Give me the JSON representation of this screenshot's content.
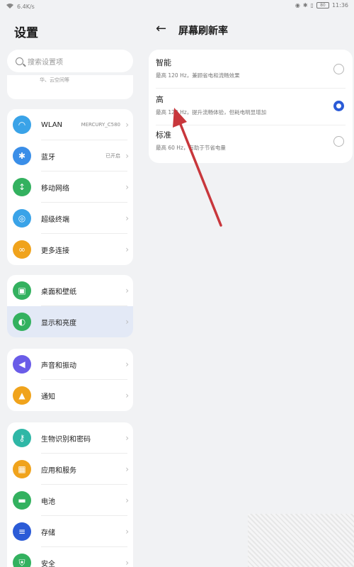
{
  "status_bar": {
    "left_text": "6.4K/s",
    "time": "11:36",
    "battery": "80"
  },
  "left": {
    "title": "设置",
    "search_placeholder": "搜索设置项",
    "account_hint": "华、云空间等",
    "groups": [
      [
        {
          "label": "WLAN",
          "sub": "MERCURY_C580",
          "icon": "wifi-icon",
          "color": "#3aa3e8"
        },
        {
          "label": "蓝牙",
          "sub": "已开启",
          "icon": "bluetooth-icon",
          "color": "#3a8ee8"
        },
        {
          "label": "移动网络",
          "sub": "",
          "icon": "signal-icon",
          "color": "#33b15f"
        },
        {
          "label": "超级终端",
          "sub": "",
          "icon": "super-device-icon",
          "color": "#3aa3e8"
        },
        {
          "label": "更多连接",
          "sub": "",
          "icon": "link-icon",
          "color": "#f0a31c"
        }
      ],
      [
        {
          "label": "桌面和壁纸",
          "sub": "",
          "icon": "wallpaper-icon",
          "color": "#33b15f"
        },
        {
          "label": "显示和亮度",
          "sub": "",
          "icon": "display-icon",
          "color": "#33b15f",
          "selected": true
        }
      ],
      [
        {
          "label": "声音和振动",
          "sub": "",
          "icon": "sound-icon",
          "color": "#6a5ce8"
        },
        {
          "label": "通知",
          "sub": "",
          "icon": "bell-icon",
          "color": "#f0a31c"
        }
      ],
      [
        {
          "label": "生物识别和密码",
          "sub": "",
          "icon": "key-icon",
          "color": "#2fb7a6"
        },
        {
          "label": "应用和服务",
          "sub": "",
          "icon": "apps-icon",
          "color": "#f0a31c"
        },
        {
          "label": "电池",
          "sub": "",
          "icon": "battery-icon",
          "color": "#33b15f"
        },
        {
          "label": "存储",
          "sub": "",
          "icon": "storage-icon",
          "color": "#2b5bd7"
        },
        {
          "label": "安全",
          "sub": "",
          "icon": "shield-icon",
          "color": "#33b15f"
        }
      ]
    ]
  },
  "right": {
    "title": "屏幕刷新率",
    "options": [
      {
        "title": "智能",
        "desc": "最高 120 Hz，兼顾省电和流畅效果",
        "selected": false
      },
      {
        "title": "高",
        "desc": "最高 120 Hz，提升流畅体验，但耗电明显增加",
        "selected": true
      },
      {
        "title": "标准",
        "desc": "最高 60 Hz，有助于节省电量",
        "selected": false
      }
    ]
  },
  "colors": {
    "accent": "#2b5bd7",
    "arrow": "#c8373c"
  }
}
